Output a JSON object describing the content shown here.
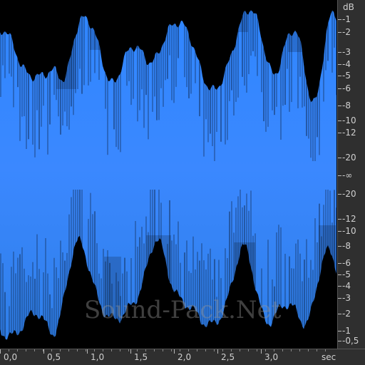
{
  "waveform": {
    "fill_color": "#2f86ff",
    "background_color": "#000000",
    "watermark": "Sound-Pack.Net"
  },
  "db_scale": {
    "unit": "dB",
    "labels": [
      "-1",
      "-2",
      "-3",
      "-4",
      "-5",
      "-6",
      "-8",
      "-10",
      "-12",
      "-20",
      "-∞",
      "-20",
      "-12",
      "-10",
      "-8",
      "-6",
      "-5",
      "-4",
      "-3",
      "-2",
      "-1",
      "-0,5"
    ]
  },
  "time_axis": {
    "labels": [
      "0,0",
      "0,5",
      "1,0",
      "1,5",
      "2,0",
      "2,5",
      "3,0"
    ],
    "unit": "sec"
  }
}
